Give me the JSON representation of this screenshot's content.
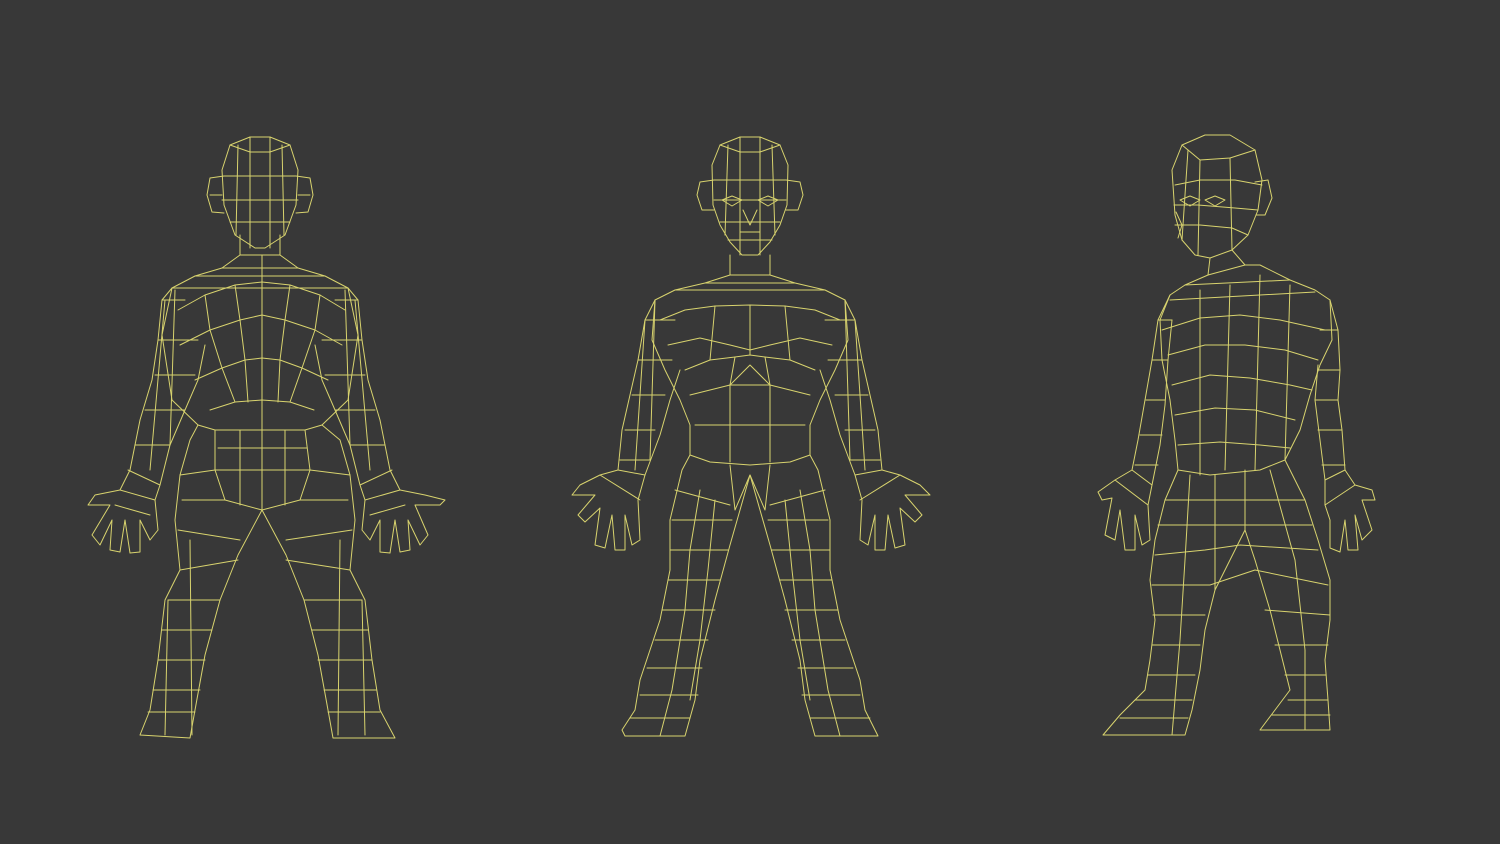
{
  "viewport": {
    "background": "#383838",
    "wire_color": "#d8d36e",
    "views": [
      {
        "id": "back",
        "label": ""
      },
      {
        "id": "front",
        "label": ""
      },
      {
        "id": "side",
        "label": ""
      }
    ]
  }
}
